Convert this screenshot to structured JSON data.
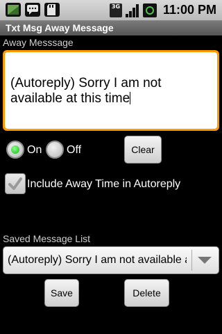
{
  "status_bar": {
    "icons_left": [
      "android-icon",
      "chat-bubble-icon",
      "sd-card-icon"
    ],
    "network_label": "3G",
    "time": "11:00 PM"
  },
  "title": "Txt Msg Away Message",
  "away_message": {
    "label": "Away Messsage",
    "value": "(Autoreply) Sorry I am not available at this time"
  },
  "radios": [
    {
      "label": "On",
      "checked": true
    },
    {
      "label": "Off",
      "checked": false
    }
  ],
  "clear_button": "Clear",
  "include_checkbox": {
    "label": "Include Away Time in Autoreply",
    "checked": true
  },
  "saved_list": {
    "label": "Saved Message List",
    "selected": "(Autoreply) Sorry I am not available at this time"
  },
  "save_button": "Save",
  "delete_button": "Delete"
}
